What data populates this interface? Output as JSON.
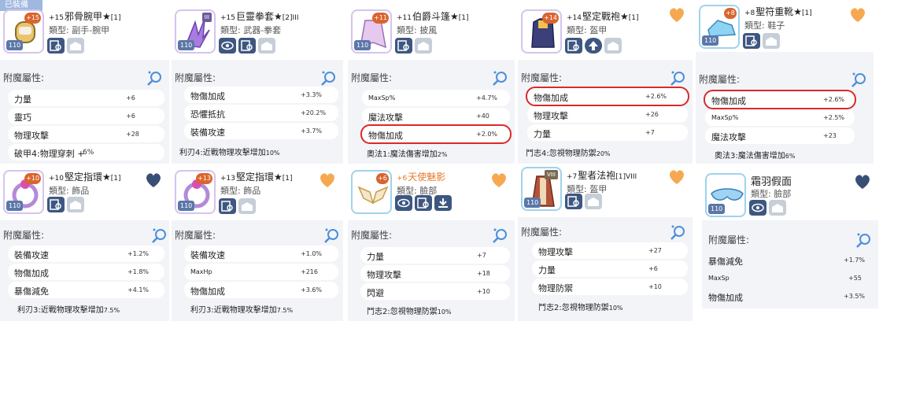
{
  "equipped_label": "已裝備",
  "enchant_label": "附魔屬性:",
  "colors": {
    "button": "#3e5781",
    "heart_dark": "#3a4f77",
    "heart_orange": "#f6a850",
    "highlight": "#d92a2a",
    "title_orange": "#e8782d"
  },
  "cards": [
    {
      "plus": "+15",
      "name": "邪骨腕甲★",
      "suffix": "[1]",
      "type": "類型: 副手-腕甲",
      "lv": "110",
      "stars": "",
      "heart": "none",
      "stats": [
        {
          "k": "力量",
          "v": "+6"
        },
        {
          "k": "靈巧",
          "v": "+6"
        },
        {
          "k": "物理攻擊",
          "v": "+28"
        }
      ],
      "bottom_main": "破甲4:物理穿刺 + ",
      "bottom_small": "6%"
    },
    {
      "plus": "+15",
      "name": "巨靈拳套★",
      "suffix": "[2]III",
      "type": "類型: 武器-拳套",
      "lv": "110",
      "stars": "III",
      "heart": "none",
      "stats": [
        {
          "k": "物傷加成",
          "v": "+3.3%"
        },
        {
          "k": "恐懼抵抗",
          "v": "+20.2%"
        },
        {
          "k": "裝備攻速",
          "v": "+3.7%"
        }
      ],
      "bottom_main": "利刃4:近戰物理攻擊增加",
      "bottom_small": "10%"
    },
    {
      "plus": "+11",
      "name": "伯爵斗篷★",
      "suffix": "[1]",
      "type": "類型: 披風",
      "lv": "110",
      "stars": "",
      "heart": "none",
      "stats": [
        {
          "k": "MaxSp%",
          "v": "+4.7%"
        },
        {
          "k": "魔法攻擊",
          "v": "+40"
        },
        {
          "k": "物傷加成",
          "v": "+2.0%"
        }
      ],
      "bottom_main": "奧法1:魔法傷害增加",
      "bottom_small": "2%"
    },
    {
      "plus": "+14",
      "name": "堅定戰袍★",
      "suffix": "[1]",
      "type": "類型: 盔甲",
      "lv": "",
      "stars": "",
      "heart": "orange",
      "stats": [
        {
          "k": "物傷加成",
          "v": "+2.6%"
        },
        {
          "k": "物理攻擊",
          "v": "+26"
        },
        {
          "k": "力量",
          "v": "+7"
        }
      ],
      "bottom_main": "鬥志4:忽視物理防禦",
      "bottom_small": "20%"
    },
    {
      "plus": "+8",
      "name": "聖符重靴★",
      "suffix": "[1]",
      "type": "類型: 鞋子",
      "lv": "110",
      "stars": "",
      "heart": "orange",
      "stats": [
        {
          "k": "物傷加成",
          "v": "+2.6%"
        },
        {
          "k": "MaxSp%",
          "v": "+2.5%"
        },
        {
          "k": "魔法攻擊",
          "v": "+23"
        }
      ],
      "bottom_main": "奧法3:魔法傷害增加",
      "bottom_small": "6%"
    },
    {
      "plus": "+10",
      "name": "堅定指環★",
      "suffix": "[1]",
      "type": "類型: 飾品",
      "lv": "110",
      "stars": "",
      "heart": "dark",
      "stats": [
        {
          "k": "裝備攻速",
          "v": "+1.2%"
        },
        {
          "k": "物傷加成",
          "v": "+1.8%"
        },
        {
          "k": "暴傷減免",
          "v": "+4.1%"
        }
      ],
      "bottom_main": "利刃3:近戰物理攻擊增加",
      "bottom_small": "7.5%"
    },
    {
      "plus": "+13",
      "name": "堅定指環★",
      "suffix": "[1]",
      "type": "類型: 飾品",
      "lv": "110",
      "stars": "",
      "heart": "orange",
      "stats": [
        {
          "k": "裝備攻速",
          "v": "+1.0%"
        },
        {
          "k": "MaxHp",
          "v": "+216"
        },
        {
          "k": "物傷加成",
          "v": "+3.6%"
        }
      ],
      "bottom_main": "利刃3:近戰物理攻擊增加",
      "bottom_small": "7.5%"
    },
    {
      "plus": "+6",
      "name": "天使魅影",
      "suffix": "",
      "type": "類型: 臉部",
      "lv": "",
      "stars": "",
      "heart": "orange",
      "stats": [
        {
          "k": "力量",
          "v": "+7"
        },
        {
          "k": "物理攻擊",
          "v": "+18"
        },
        {
          "k": "閃避",
          "v": "+10"
        }
      ],
      "bottom_main": "鬥志2:忽視物理防禦",
      "bottom_small": "10%"
    },
    {
      "plus": "+7",
      "name": "聖者法袍",
      "suffix": "[1]VIII",
      "type": "類型: 盔甲",
      "lv": "110",
      "stars": "VIII",
      "heart": "orange",
      "stats": [
        {
          "k": "物理攻擊",
          "v": "+27"
        },
        {
          "k": "力量",
          "v": "+6"
        },
        {
          "k": "物理防禦",
          "v": "+10"
        }
      ],
      "bottom_main": "鬥志2:忽視物理防禦",
      "bottom_small": "10%"
    },
    {
      "plus": "",
      "name": "霜羽假面",
      "suffix": "",
      "type": "類型: 臉部",
      "lv": "110",
      "stars": "",
      "heart": "dark",
      "stats": [
        {
          "k": "暴傷減免",
          "v": "+1.7%"
        },
        {
          "k": "MaxSp",
          "v": "+55"
        },
        {
          "k": "物傷加成",
          "v": "+3.5%"
        }
      ],
      "bottom_main": "",
      "bottom_small": ""
    }
  ]
}
